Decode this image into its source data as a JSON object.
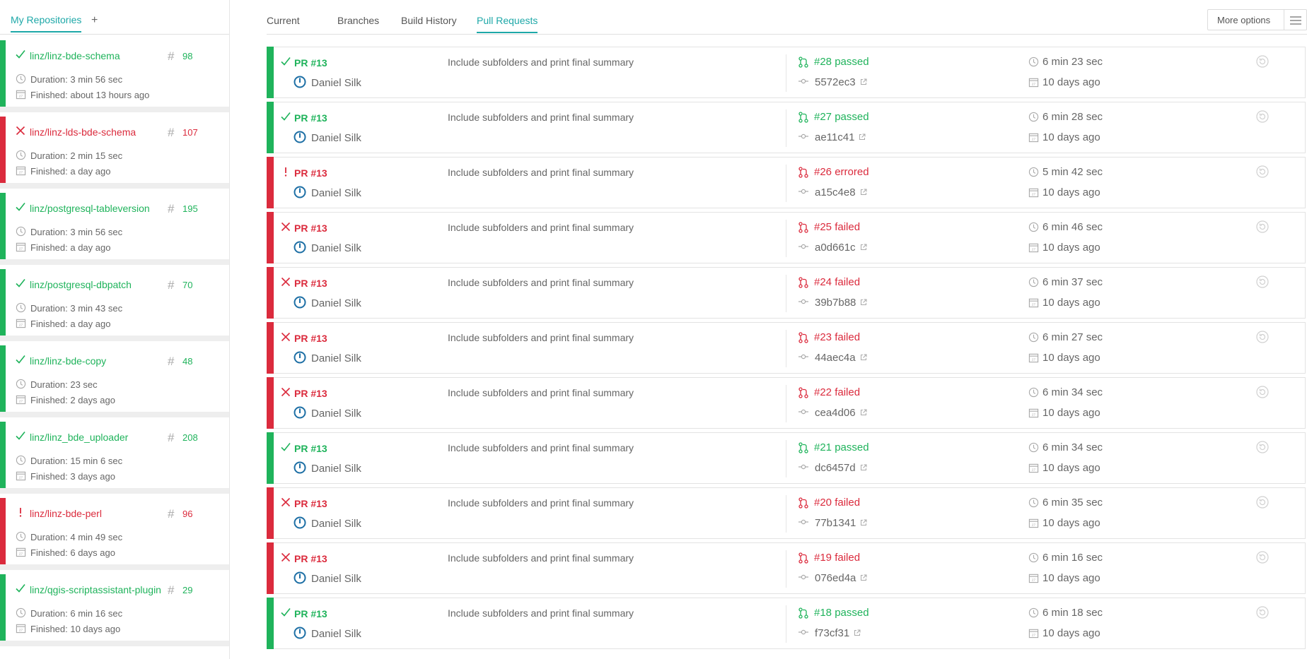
{
  "sidebar": {
    "tab_label": "My Repositories",
    "add_label": "+",
    "repos": [
      {
        "name": "linz/linz-bde-schema",
        "status": "passed",
        "number": "98",
        "duration": "Duration: 3 min 56 sec",
        "finished": "Finished: about 13 hours ago"
      },
      {
        "name": "linz/linz-lds-bde-schema",
        "status": "failed",
        "number": "107",
        "duration": "Duration: 2 min 15 sec",
        "finished": "Finished: a day ago"
      },
      {
        "name": "linz/postgresql-tableversion",
        "status": "passed",
        "number": "195",
        "duration": "Duration: 3 min 56 sec",
        "finished": "Finished: a day ago"
      },
      {
        "name": "linz/postgresql-dbpatch",
        "status": "passed",
        "number": "70",
        "duration": "Duration: 3 min 43 sec",
        "finished": "Finished: a day ago"
      },
      {
        "name": "linz/linz-bde-copy",
        "status": "passed",
        "number": "48",
        "duration": "Duration: 23 sec",
        "finished": "Finished: 2 days ago"
      },
      {
        "name": "linz/linz_bde_uploader",
        "status": "passed",
        "number": "208",
        "duration": "Duration: 15 min 6 sec",
        "finished": "Finished: 3 days ago"
      },
      {
        "name": "linz/linz-bde-perl",
        "status": "errored",
        "number": "96",
        "duration": "Duration: 4 min 49 sec",
        "finished": "Finished: 6 days ago"
      },
      {
        "name": "linz/qgis-scriptassistant-plugin",
        "status": "passed",
        "number": "29",
        "duration": "Duration: 6 min 16 sec",
        "finished": "Finished: 10 days ago"
      }
    ]
  },
  "main": {
    "tabs": [
      {
        "label": "Current",
        "active": false
      },
      {
        "label": "Branches",
        "active": false
      },
      {
        "label": "Build History",
        "active": false
      },
      {
        "label": "Pull Requests",
        "active": true
      }
    ],
    "more_options_label": "More options",
    "builds": [
      {
        "pr": "PR #13",
        "author": "Daniel Silk",
        "message": "Include subfolders and print final summary",
        "state": "#28 passed",
        "status": "passed",
        "sha": "5572ec3",
        "duration": "6 min 23 sec",
        "finished": "10 days ago"
      },
      {
        "pr": "PR #13",
        "author": "Daniel Silk",
        "message": "Include subfolders and print final summary",
        "state": "#27 passed",
        "status": "passed",
        "sha": "ae11c41",
        "duration": "6 min 28 sec",
        "finished": "10 days ago"
      },
      {
        "pr": "PR #13",
        "author": "Daniel Silk",
        "message": "Include subfolders and print final summary",
        "state": "#26 errored",
        "status": "errored",
        "sha": "a15c4e8",
        "duration": "5 min 42 sec",
        "finished": "10 days ago"
      },
      {
        "pr": "PR #13",
        "author": "Daniel Silk",
        "message": "Include subfolders and print final summary",
        "state": "#25 failed",
        "status": "failed",
        "sha": "a0d661c",
        "duration": "6 min 46 sec",
        "finished": "10 days ago"
      },
      {
        "pr": "PR #13",
        "author": "Daniel Silk",
        "message": "Include subfolders and print final summary",
        "state": "#24 failed",
        "status": "failed",
        "sha": "39b7b88",
        "duration": "6 min 37 sec",
        "finished": "10 days ago"
      },
      {
        "pr": "PR #13",
        "author": "Daniel Silk",
        "message": "Include subfolders and print final summary",
        "state": "#23 failed",
        "status": "failed",
        "sha": "44aec4a",
        "duration": "6 min 27 sec",
        "finished": "10 days ago"
      },
      {
        "pr": "PR #13",
        "author": "Daniel Silk",
        "message": "Include subfolders and print final summary",
        "state": "#22 failed",
        "status": "failed",
        "sha": "cea4d06",
        "duration": "6 min 34 sec",
        "finished": "10 days ago"
      },
      {
        "pr": "PR #13",
        "author": "Daniel Silk",
        "message": "Include subfolders and print final summary",
        "state": "#21 passed",
        "status": "passed",
        "sha": "dc6457d",
        "duration": "6 min 34 sec",
        "finished": "10 days ago"
      },
      {
        "pr": "PR #13",
        "author": "Daniel Silk",
        "message": "Include subfolders and print final summary",
        "state": "#20 failed",
        "status": "failed",
        "sha": "77b1341",
        "duration": "6 min 35 sec",
        "finished": "10 days ago"
      },
      {
        "pr": "PR #13",
        "author": "Daniel Silk",
        "message": "Include subfolders and print final summary",
        "state": "#19 failed",
        "status": "failed",
        "sha": "076ed4a",
        "duration": "6 min 16 sec",
        "finished": "10 days ago"
      },
      {
        "pr": "PR #13",
        "author": "Daniel Silk",
        "message": "Include subfolders and print final summary",
        "state": "#18 passed",
        "status": "passed",
        "sha": "f73cf31",
        "duration": "6 min 18 sec",
        "finished": "10 days ago"
      }
    ]
  },
  "colors": {
    "passed": "#1fb35b",
    "failed": "#db2b3d",
    "errored": "#db2b3d",
    "accent": "#1ea8a8"
  },
  "icons": {
    "passed": "check-icon",
    "failed": "cross-icon",
    "errored": "exclamation-icon"
  }
}
